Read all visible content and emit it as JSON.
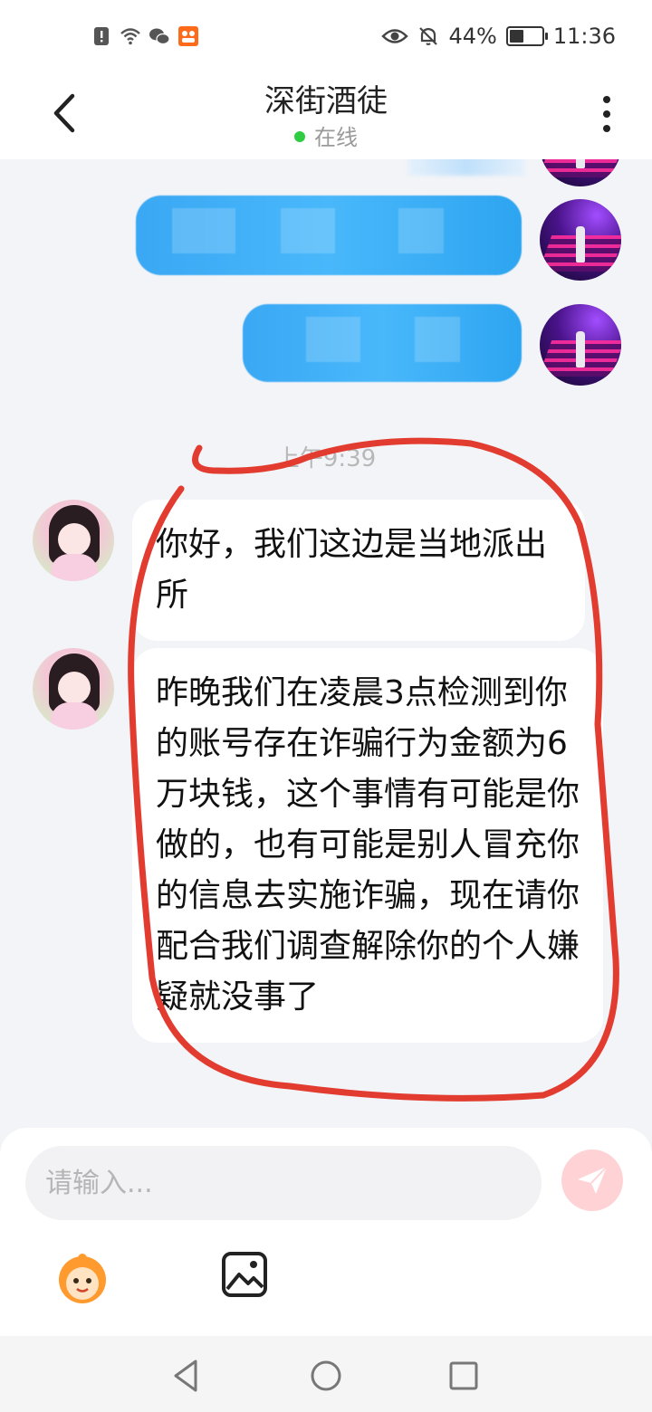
{
  "status_bar": {
    "battery_text": "44%",
    "battery_level": 0.44,
    "time": "11:36"
  },
  "header": {
    "title": "深街酒徒",
    "presence": "在线"
  },
  "chat": {
    "timestamp": "上午9:39",
    "peer_messages": [
      "你好，我们这边是当地派出所",
      "昨晚我们在凌晨3点检测到你的账号存在诈骗行为金额为6万块钱，这个事情有可能是你做的，也有可能是别人冒充你的信息去实施诈骗，现在请你配合我们调查解除你的个人嫌疑就没事了"
    ]
  },
  "composer": {
    "placeholder": "请输入..."
  },
  "colors": {
    "annotation": "#e23b30",
    "outgoing_bubble": "#3aa8f4",
    "online_dot": "#2ecc40"
  }
}
